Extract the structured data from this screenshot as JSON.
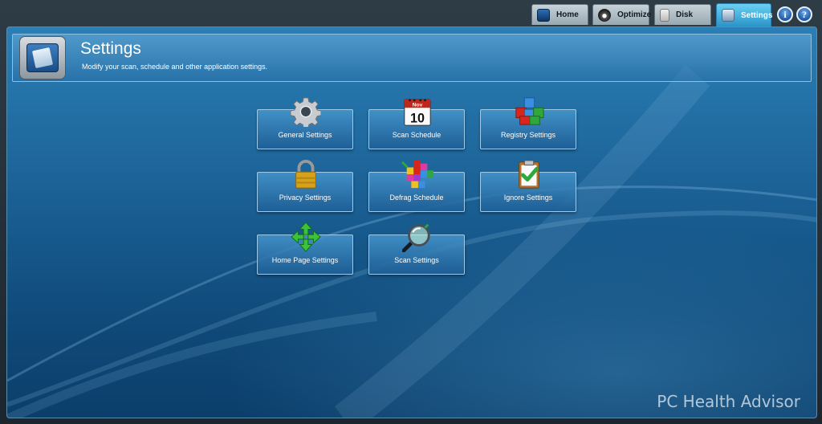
{
  "tabs": [
    {
      "label": "Home",
      "icon": "monitor-icon",
      "active": false
    },
    {
      "label": "Optimize",
      "icon": "speedometer-icon",
      "active": false
    },
    {
      "label": "Disk",
      "icon": "disk-icon",
      "active": false
    },
    {
      "label": "Settings",
      "icon": "settings-icon",
      "active": true
    }
  ],
  "header_buttons": {
    "info": "i",
    "help": "?"
  },
  "header": {
    "title": "Settings",
    "subtitle": "Modify your scan, schedule and other application settings.",
    "icon": "settings-panel-icon"
  },
  "tiles": [
    {
      "label": "General Settings",
      "icon": "gear-icon"
    },
    {
      "label": "Scan Schedule",
      "icon": "calendar-icon",
      "calendar_month": "Nov",
      "calendar_day": "10"
    },
    {
      "label": "Registry Settings",
      "icon": "cubes-icon"
    },
    {
      "label": "Privacy Settings",
      "icon": "padlock-icon"
    },
    {
      "label": "Defrag Schedule",
      "icon": "blocks-icon"
    },
    {
      "label": "Ignore Settings",
      "icon": "clipboard-check-icon"
    },
    {
      "label": "Home Page Settings",
      "icon": "move-arrows-icon"
    },
    {
      "label": "Scan Settings",
      "icon": "magnifier-icon"
    }
  ],
  "brand": "PC Health Advisor",
  "colors": {
    "accent": "#2a94c8",
    "panel": "#1a5f93"
  }
}
